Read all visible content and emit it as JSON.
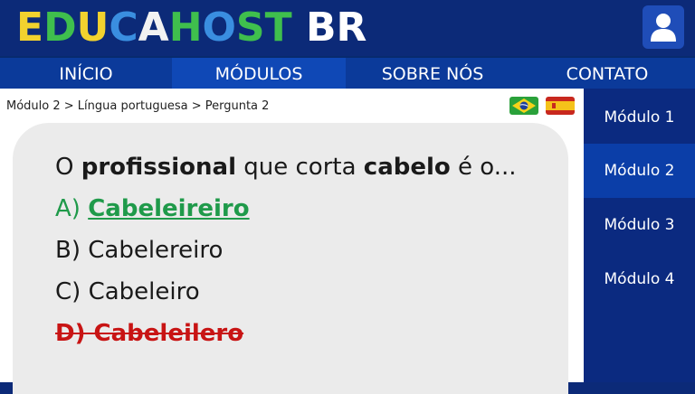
{
  "header": {
    "logo_letters": [
      {
        "ch": "E",
        "color": "#f2d22e"
      },
      {
        "ch": "D",
        "color": "#3fbf4d"
      },
      {
        "ch": "U",
        "color": "#f2d22e"
      },
      {
        "ch": "C",
        "color": "#3a8ee0"
      },
      {
        "ch": "A",
        "color": "#f2f2f2"
      },
      {
        "ch": "H",
        "color": "#3fbf4d"
      },
      {
        "ch": "O",
        "color": "#3a8ee0"
      },
      {
        "ch": "S",
        "color": "#3fbf4d"
      },
      {
        "ch": "T",
        "color": "#3fbf4d"
      },
      {
        "ch": " ",
        "color": "#ffffff"
      },
      {
        "ch": "B",
        "color": "#ffffff"
      },
      {
        "ch": "R",
        "color": "#ffffff"
      }
    ]
  },
  "nav": {
    "items": [
      "INÍCIO",
      "MÓDULOS",
      "SOBRE NÓS",
      "CONTATO"
    ],
    "active": "MÓDULOS"
  },
  "breadcrumb": "Módulo 2 > Língua portuguesa > Pergunta 2",
  "question": {
    "before": "O ",
    "bold1": "profissional",
    "middle": " que corta ",
    "bold2": "cabelo",
    "after": " é o..."
  },
  "options": [
    {
      "letter": "A) ",
      "text": "Cabeleireiro",
      "state": "correct"
    },
    {
      "letter": "B) ",
      "text": "Cabelereiro",
      "state": "normal"
    },
    {
      "letter": "C) ",
      "text": "Cabeleiro",
      "state": "normal"
    },
    {
      "letter": "D) ",
      "text": "Cabeleilero",
      "state": "wrong"
    }
  ],
  "sidebar": {
    "items": [
      "Módulo 1",
      "Módulo 2",
      "Módulo 3",
      "Módulo 4"
    ],
    "active": "Módulo 2"
  },
  "colors": {
    "brand_dark": "#0c2a78",
    "correct": "#1f9a4a",
    "wrong": "#c81414"
  },
  "icons": {
    "user": "user-icon",
    "flag_br": "flag-brazil-icon",
    "flag_es": "flag-spain-icon"
  }
}
